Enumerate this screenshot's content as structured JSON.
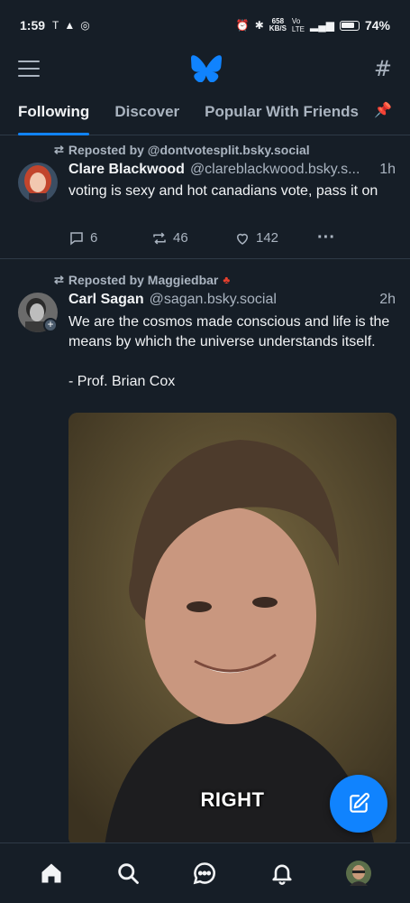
{
  "status_bar": {
    "time": "1:59",
    "net_speed_value": "658",
    "net_speed_unit": "KB/S",
    "battery": "74%"
  },
  "tabs": [
    {
      "label": "Following",
      "active": true
    },
    {
      "label": "Discover",
      "active": false
    },
    {
      "label": "Popular With Friends",
      "active": false
    }
  ],
  "posts": [
    {
      "repost_label": "Reposted by @dontvotesplit.bsky.social",
      "author_name": "Clare Blackwood",
      "author_handle": "@clareblackwood.bsky.s...",
      "time": "1h",
      "text": "voting is sexy and hot canadians vote, pass it on",
      "replies": "6",
      "reposts": "46",
      "likes": "142"
    },
    {
      "repost_label": "Reposted by Maggiedbar",
      "author_name": "Carl Sagan",
      "author_handle": "@sagan.bsky.social",
      "time": "2h",
      "text": "We are the cosmos made conscious and life is the means by which the universe understands itself.\n\n- Prof. Brian Cox",
      "media_caption": "RIGHT"
    }
  ],
  "colors": {
    "background": "#161e27",
    "accent": "#1083fe",
    "muted": "#aab4c0",
    "divider": "#2e3a47"
  },
  "icons": {
    "menu": "hamburger-icon",
    "logo": "butterfly-logo",
    "feeds": "hash-icon",
    "pin": "pin-icon",
    "compose": "compose-icon",
    "home": "home-icon",
    "search": "search-icon",
    "chat": "chat-icon",
    "notifications": "bell-icon"
  }
}
